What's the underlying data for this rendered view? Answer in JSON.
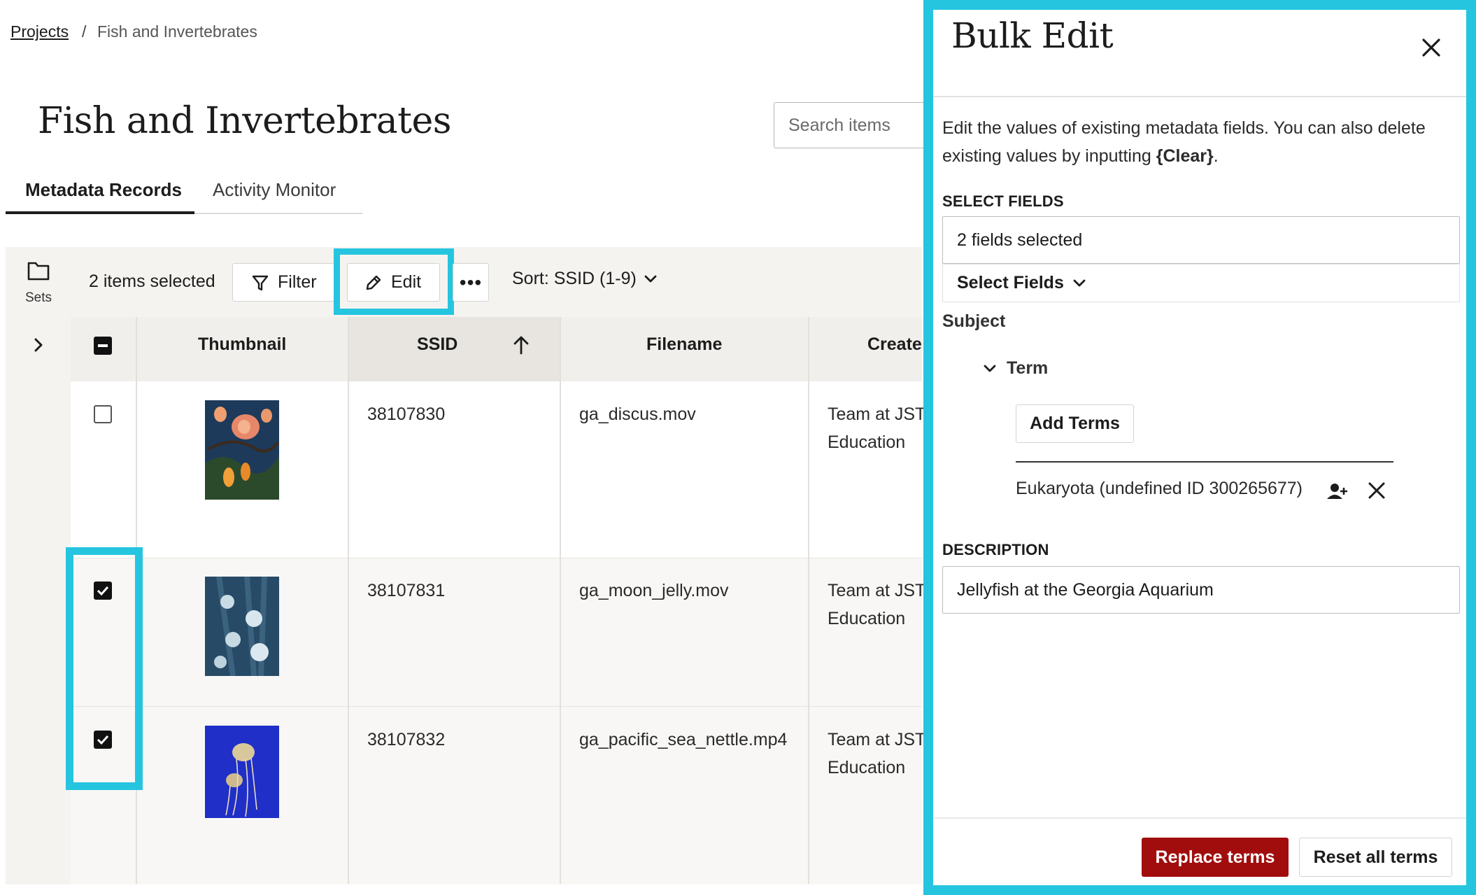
{
  "breadcrumb": {
    "link": "Projects",
    "separator": "/",
    "current": "Fish and Invertebrates"
  },
  "page_title": "Fish and Invertebrates",
  "search": {
    "placeholder": "Search items"
  },
  "tabs": [
    {
      "label": "Metadata Records",
      "active": true
    },
    {
      "label": "Activity Monitor",
      "active": false
    }
  ],
  "rail": {
    "sets_label": "Sets"
  },
  "toolbar": {
    "selected_count": "2 items selected",
    "filter_label": "Filter",
    "edit_label": "Edit",
    "more_label": "•••",
    "sort_label": "Sort: SSID (1-9)"
  },
  "table": {
    "columns": [
      "Thumbnail",
      "SSID",
      "Filename",
      "Create"
    ],
    "rows": [
      {
        "checked": false,
        "ssid": "38107830",
        "filename": "ga_discus.mov",
        "created_line1": "Team at JST",
        "created_line2": "Education"
      },
      {
        "checked": true,
        "ssid": "38107831",
        "filename": "ga_moon_jelly.mov",
        "created_line1": "Team at JST",
        "created_line2": "Education"
      },
      {
        "checked": true,
        "ssid": "38107832",
        "filename": "ga_pacific_sea_nettle.mp4",
        "created_line1": "Team at JST",
        "created_line2": "Education"
      }
    ]
  },
  "panel": {
    "title": "Bulk Edit",
    "description_text": "Edit the values of existing metadata fields. You can also delete existing values by inputting ",
    "description_token": "{Clear}",
    "description_end": ".",
    "select_fields_label": "SELECT FIELDS",
    "fields_selected_value": "2 fields selected",
    "select_fields_button": "Select Fields",
    "subject_label": "Subject",
    "term_label": "Term",
    "add_terms_label": "Add Terms",
    "term_value": "Eukaryota (undefined ID 300265677)",
    "description_label": "DESCRIPTION",
    "description_value": "Jellyfish at the Georgia Aquarium",
    "replace_label": "Replace terms",
    "reset_label": "Reset all terms"
  },
  "colors": {
    "highlight": "#25c5e0",
    "primary_button": "#a10d0d"
  },
  "icons": [
    "folder-icon",
    "chevron-right-icon",
    "filter-icon",
    "pencil-icon",
    "chevron-down-icon",
    "arrow-up-icon",
    "close-icon",
    "add-person-icon"
  ]
}
